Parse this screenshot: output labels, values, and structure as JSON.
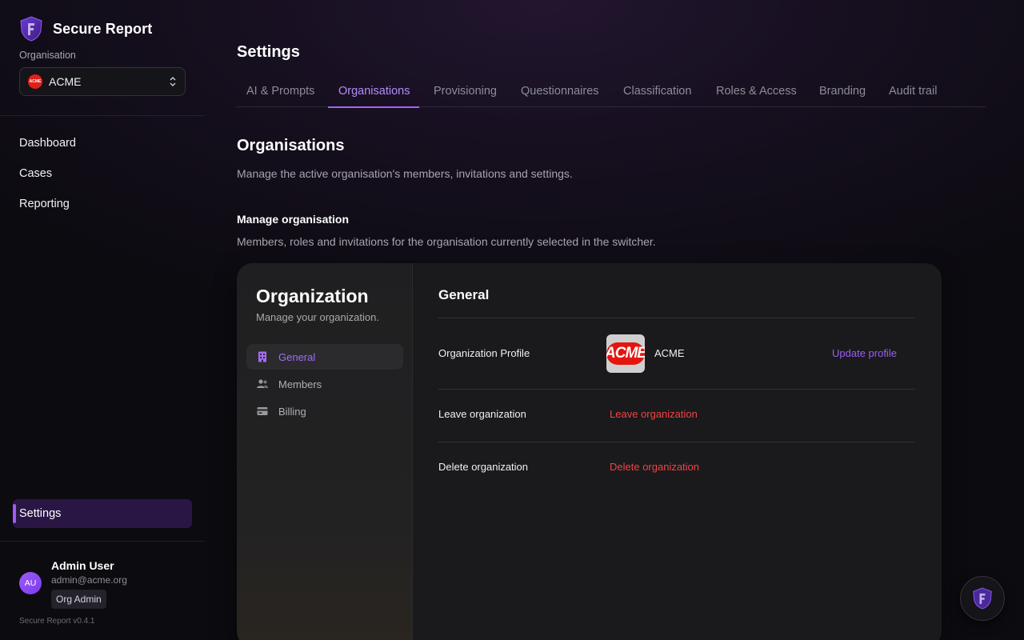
{
  "brand": {
    "name": "Secure Report",
    "logo_icon": "shield-logo-icon"
  },
  "org_switcher": {
    "label": "Organisation",
    "selected": "ACME",
    "logo_text": "ACME"
  },
  "nav": {
    "items": [
      {
        "label": "Dashboard"
      },
      {
        "label": "Cases"
      },
      {
        "label": "Reporting"
      }
    ],
    "settings": "Settings"
  },
  "user": {
    "initials": "AU",
    "name": "Admin User",
    "email": "admin@acme.org",
    "role": "Org Admin"
  },
  "version": "Secure Report v0.4.1",
  "page": {
    "title": "Settings"
  },
  "tabs": [
    {
      "label": "AI & Prompts"
    },
    {
      "label": "Organisations",
      "active": true
    },
    {
      "label": "Provisioning"
    },
    {
      "label": "Questionnaires"
    },
    {
      "label": "Classification"
    },
    {
      "label": "Roles & Access"
    },
    {
      "label": "Branding"
    },
    {
      "label": "Audit trail"
    }
  ],
  "section": {
    "title": "Organisations",
    "description": "Manage the active organisation's members, invitations and settings.",
    "sub_title": "Manage organisation",
    "sub_description": "Members, roles and invitations for the organisation currently selected in the switcher."
  },
  "org_card": {
    "title": "Organization",
    "subtitle": "Manage your organization.",
    "nav": [
      {
        "label": "General",
        "icon": "building-icon",
        "active": true
      },
      {
        "label": "Members",
        "icon": "users-icon"
      },
      {
        "label": "Billing",
        "icon": "credit-card-icon"
      }
    ],
    "general": {
      "title": "General",
      "profile_label": "Organization Profile",
      "org_name": "ACME",
      "logo_text": "ACME",
      "update_link": "Update profile",
      "leave_label": "Leave organization",
      "leave_link": "Leave organization",
      "delete_label": "Delete organization",
      "delete_link": "Delete organization"
    }
  },
  "colors": {
    "accent": "#a463f2",
    "danger": "#ef4444",
    "active_nav_bg": "#2a1645"
  }
}
